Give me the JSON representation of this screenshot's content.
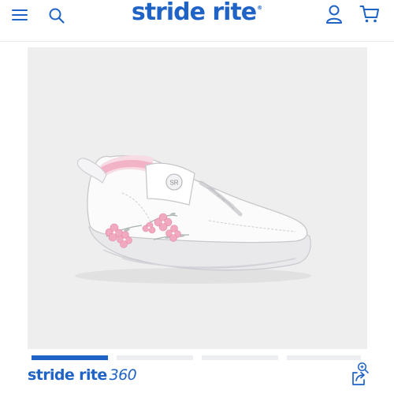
{
  "header": {
    "logo_text": "stride rite",
    "logo_mark": "®",
    "icons": [
      "menu-icon",
      "search-icon",
      "account-icon",
      "cart-icon"
    ]
  },
  "product_image": {
    "alt": "White toddler sneaker with pink floral embroidery",
    "badge_text": "SR",
    "zoom_icon": "zoom-in-icon"
  },
  "carousel": {
    "count": 4,
    "active_index": 0
  },
  "footer_bar": {
    "brand_text": "stride rite",
    "brand_suffix": "360",
    "share_icon": "share-icon"
  },
  "colors": {
    "brand": "#1f63c6",
    "image_bg": "#eeeeee",
    "inactive_dot": "#eceef2",
    "accent_pink": "#f1a9bf"
  }
}
